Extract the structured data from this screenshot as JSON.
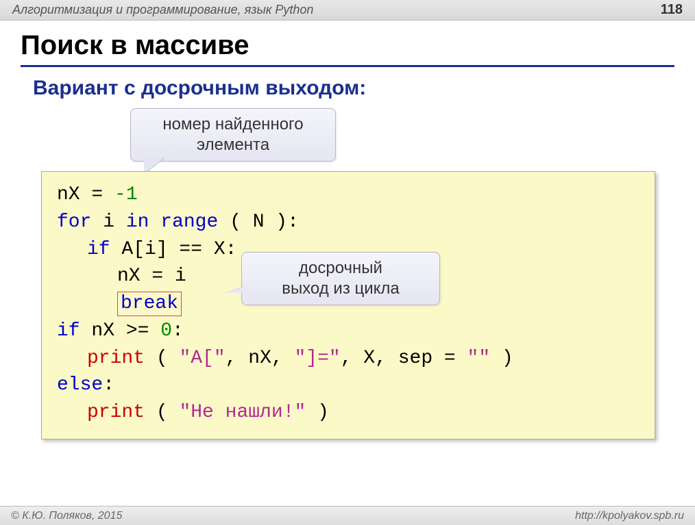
{
  "header": {
    "course": "Алгоритмизация и программирование, язык Python",
    "page": "118"
  },
  "title": "Поиск в массиве",
  "subtitle": "Вариант с досрочным выходом:",
  "callouts": {
    "found_index": "номер найденного\nэлемента",
    "early_exit": "досрочный\nвыход из цикла"
  },
  "code": {
    "l1_a": "nX",
    "l1_b": " = ",
    "l1_c": "-1",
    "l2_for": "for",
    "l2_mid1": " i ",
    "l2_in": "in",
    "l2_mid2": " ",
    "l2_range": "range",
    "l2_end": " ( N ):",
    "l3_if": "if",
    "l3_rest": " A[i] == X:",
    "l4": "nX = i",
    "l5_break": "break",
    "l6_if": "if",
    "l6_mid": " nX >= ",
    "l6_zero": "0",
    "l6_end": ":",
    "l7_print": "print",
    "l7_a": " ( ",
    "l7_s1": "\"A[\"",
    "l7_b": ", nX, ",
    "l7_s2": "\"]=\"",
    "l7_c": ", X, sep = ",
    "l7_s3": "\"\"",
    "l7_d": " )",
    "l8_else": "else",
    "l8_colon": ":",
    "l9_print": "print",
    "l9_a": " ( ",
    "l9_s": "\"Не нашли!\"",
    "l9_b": " )"
  },
  "footer": {
    "copyright": "© К.Ю. Поляков, 2015",
    "url": "http://kpolyakov.spb.ru"
  }
}
